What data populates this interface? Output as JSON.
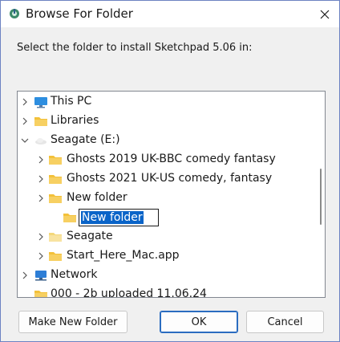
{
  "window": {
    "title": "Browse For Folder",
    "close_glyph": "✕"
  },
  "prompt": "Select the folder to install Sketchpad 5.06 in:",
  "tree": {
    "items": [
      {
        "label": "This PC",
        "icon": "monitor-icon",
        "chevron": "right"
      },
      {
        "label": "Libraries",
        "icon": "folder-icon",
        "chevron": "right"
      },
      {
        "label": "Seagate (E:)",
        "icon": "cloud-drive-icon",
        "chevron": "down"
      },
      {
        "label": "Ghosts 2019 UK-BBC comedy fantasy",
        "icon": "folder-icon",
        "chevron": "right"
      },
      {
        "label": "Ghosts 2021 UK-US comedy, fantasy",
        "icon": "folder-icon",
        "chevron": "right"
      },
      {
        "label": "New folder",
        "icon": "folder-icon",
        "chevron": "right"
      },
      {
        "label": "New folder",
        "icon": "folder-icon",
        "chevron": "none",
        "editing": true
      },
      {
        "label": "Seagate",
        "icon": "folder-icon",
        "chevron": "right"
      },
      {
        "label": "Start_Here_Mac.app",
        "icon": "folder-icon",
        "chevron": "right"
      },
      {
        "label": "Network",
        "icon": "network-icon",
        "chevron": "right"
      },
      {
        "label": "000 - 2b uploaded 11.06.24",
        "icon": "folder-icon",
        "chevron": "none"
      }
    ]
  },
  "buttons": {
    "make_new_folder": "Make New Folder",
    "ok": "OK",
    "cancel": "Cancel"
  },
  "colors": {
    "selection": "#0a64c8",
    "folder": "#f3c13a",
    "monitor": "#2d8ee0",
    "network": "#2d7ed6",
    "accent_border": "#2a6cc0"
  }
}
